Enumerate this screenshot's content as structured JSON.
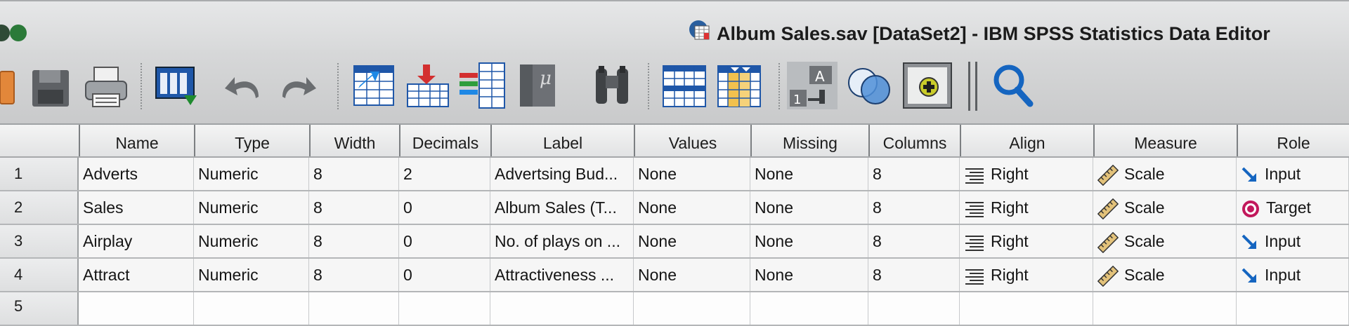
{
  "window": {
    "title": "Album Sales.sav [DataSet2] - IBM SPSS Statistics Data Editor"
  },
  "toolbar": {
    "buttons": [
      "open-data-document",
      "save-this-document",
      "print",
      "recall-recently-used-dialogs",
      "undo",
      "redo",
      "go-to-case",
      "go-to-variable",
      "variables",
      "run-descriptive-statistics",
      "find",
      "insert-cases",
      "insert-variable",
      "split-file",
      "weight-cases",
      "select-cases",
      "value-labels",
      "use-variable-sets",
      "show-all-variables",
      "spell-check"
    ]
  },
  "grid": {
    "columns": [
      "Name",
      "Type",
      "Width",
      "Decimals",
      "Label",
      "Values",
      "Missing",
      "Columns",
      "Align",
      "Measure",
      "Role"
    ],
    "rows": [
      {
        "num": "1",
        "name": "Adverts",
        "type": "Numeric",
        "width": "8",
        "decimals": "2",
        "label": "Advertsing Bud...",
        "values": "None",
        "missing": "None",
        "columns": "8",
        "align": "Right",
        "measure": "Scale",
        "role": "Input"
      },
      {
        "num": "2",
        "name": "Sales",
        "type": "Numeric",
        "width": "8",
        "decimals": "0",
        "label": "Album Sales (T...",
        "values": "None",
        "missing": "None",
        "columns": "8",
        "align": "Right",
        "measure": "Scale",
        "role": "Target"
      },
      {
        "num": "3",
        "name": "Airplay",
        "type": "Numeric",
        "width": "8",
        "decimals": "0",
        "label": "No. of plays on ...",
        "values": "None",
        "missing": "None",
        "columns": "8",
        "align": "Right",
        "measure": "Scale",
        "role": "Input"
      },
      {
        "num": "4",
        "name": "Attract",
        "type": "Numeric",
        "width": "8",
        "decimals": "0",
        "label": "Attractiveness ...",
        "values": "None",
        "missing": "None",
        "columns": "8",
        "align": "Right",
        "measure": "Scale",
        "role": "Input"
      },
      {
        "num": "5",
        "name": "",
        "type": "",
        "width": "",
        "decimals": "",
        "label": "",
        "values": "",
        "missing": "",
        "columns": "",
        "align": "",
        "measure": "",
        "role": ""
      }
    ]
  },
  "colors": {
    "accent_blue": "#1565c0",
    "target_red": "#c2185b",
    "titlebar": "#e0e1e2"
  }
}
